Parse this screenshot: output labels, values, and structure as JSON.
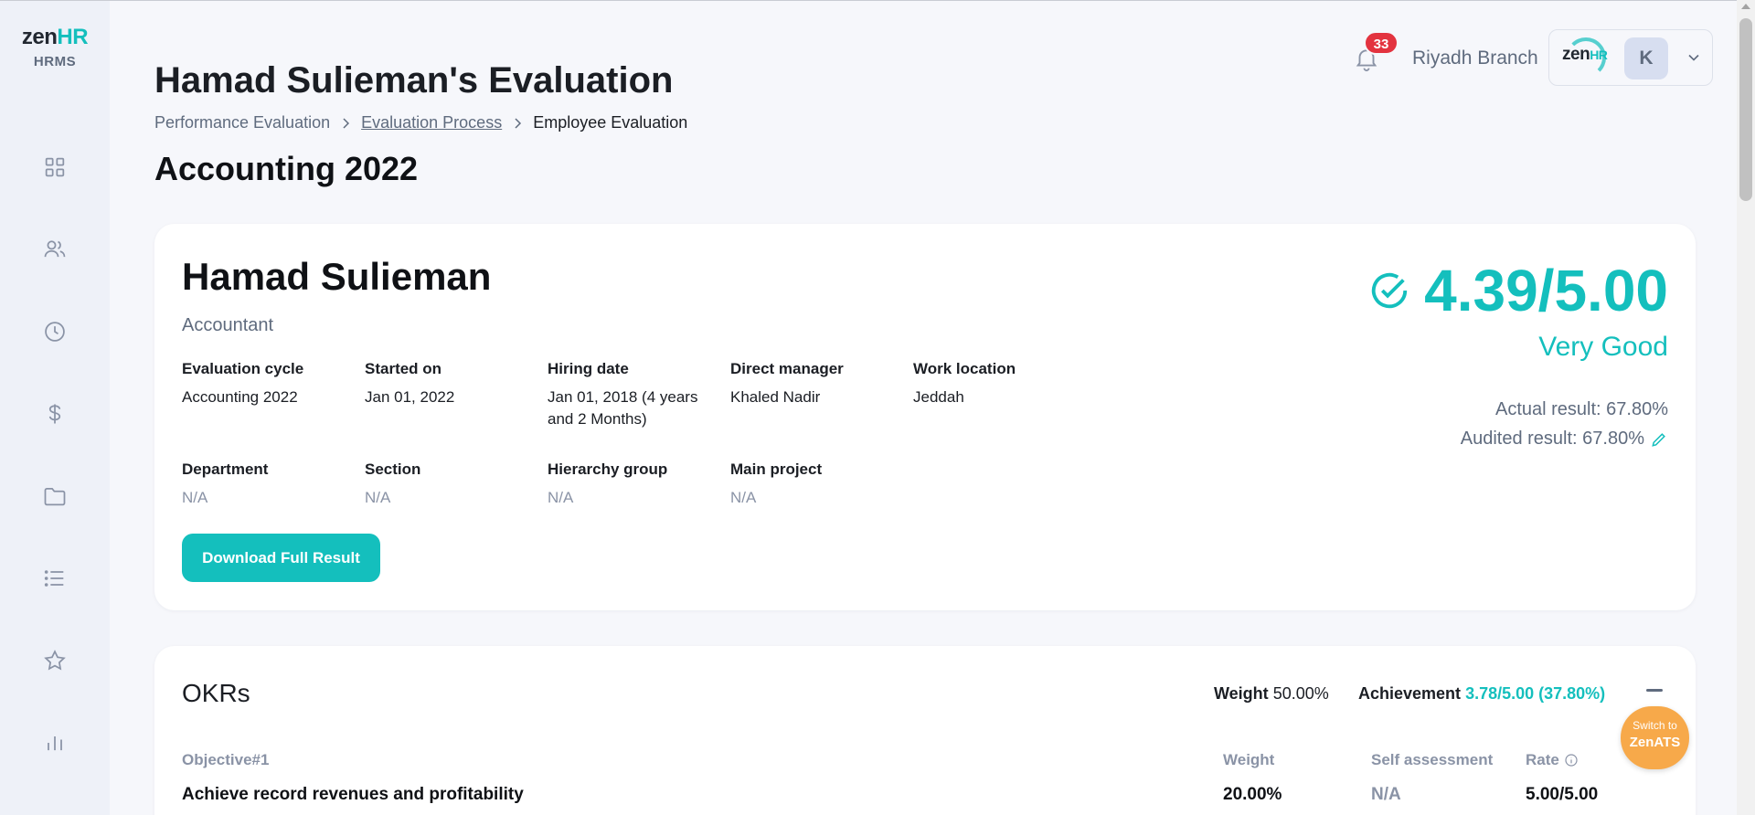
{
  "sidebar": {
    "logo_zen": "zen",
    "logo_hr": "HR",
    "logo_sub": "HRMS",
    "items": [
      {
        "name": "dashboard-icon"
      },
      {
        "name": "employees-icon"
      },
      {
        "name": "attendance-icon"
      },
      {
        "name": "payroll-icon"
      },
      {
        "name": "documents-icon"
      },
      {
        "name": "list-icon"
      },
      {
        "name": "performance-icon"
      },
      {
        "name": "reports-icon"
      }
    ]
  },
  "header": {
    "notification_count": "33",
    "branch": "Riyadh Branch",
    "user_logo_zen": "zen",
    "user_logo_hr": "HR",
    "avatar_initial": "K"
  },
  "page": {
    "title": "Hamad Sulieman's Evaluation",
    "breadcrumb": {
      "item1": "Performance Evaluation",
      "item2": "Evaluation Process",
      "item3": "Employee Evaluation"
    },
    "section_title": "Accounting 2022"
  },
  "employee": {
    "name": "Hamad Sulieman",
    "role": "Accountant",
    "fields": {
      "evaluation_cycle_label": "Evaluation cycle",
      "evaluation_cycle_value": "Accounting 2022",
      "started_on_label": "Started on",
      "started_on_value": "Jan 01, 2022",
      "hiring_date_label": "Hiring date",
      "hiring_date_value": "Jan 01, 2018 (4 years and 2 Months)",
      "direct_manager_label": "Direct manager",
      "direct_manager_value": "Khaled Nadir",
      "work_location_label": "Work location",
      "work_location_value": "Jeddah",
      "department_label": "Department",
      "department_value": "N/A",
      "section_label": "Section",
      "section_value": "N/A",
      "hierarchy_group_label": "Hierarchy group",
      "hierarchy_group_value": "N/A",
      "main_project_label": "Main project",
      "main_project_value": "N/A"
    },
    "download_button": "Download Full Result",
    "score": "4.39/5.00",
    "grade": "Very Good",
    "actual_result": "Actual result: 67.80%",
    "audited_result": "Audited result: 67.80%"
  },
  "okrs": {
    "title": "OKRs",
    "weight_label": "Weight",
    "weight_value": "50.00%",
    "achievement_label": "Achievement",
    "achievement_value": "3.78/5.00 (37.80%)",
    "columns": {
      "objective": "Objective#1",
      "weight": "Weight",
      "self_assessment": "Self assessment",
      "rate": "Rate"
    },
    "row": {
      "objective": "Achieve record revenues and profitability",
      "weight": "20.00%",
      "self_assessment": "N/A",
      "rate": "5.00/5.00"
    }
  },
  "switch_bubble": {
    "line1": "Switch to",
    "line2": "ZenATS"
  },
  "colors": {
    "accent": "#14bfbd",
    "badge": "#e3333f",
    "switch": "#f7a94a",
    "sidebar_bg": "#eef1f8"
  }
}
